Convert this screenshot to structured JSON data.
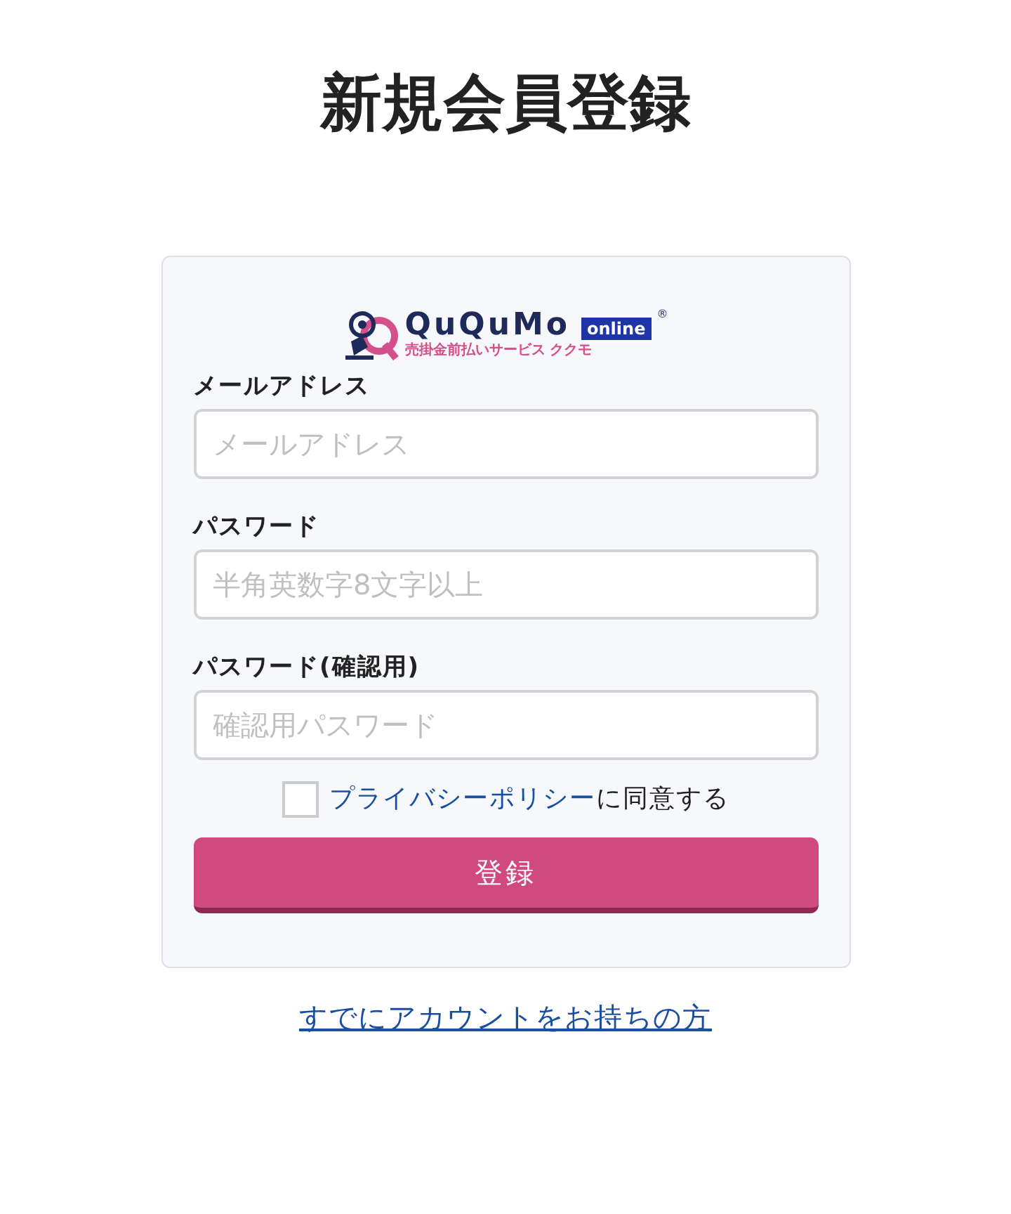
{
  "title": "新規会員登録",
  "logo": {
    "name": "QuQuMo",
    "badge": "online",
    "tagline": "売掛金前払いサービス ククモ",
    "mark": "®"
  },
  "fields": [
    {
      "label": "メールアドレス",
      "placeholder": "メールアドレス"
    },
    {
      "label": "パスワード",
      "placeholder": "半角英数字8文字以上"
    },
    {
      "label": "パスワード(確認用)",
      "placeholder": "確認用パスワード"
    }
  ],
  "agreement": {
    "checked": false,
    "link": "プライバシーポリシー",
    "text": "に同意する"
  },
  "submit": "登録",
  "login_link": "すでにアカウントをお持ちの方"
}
